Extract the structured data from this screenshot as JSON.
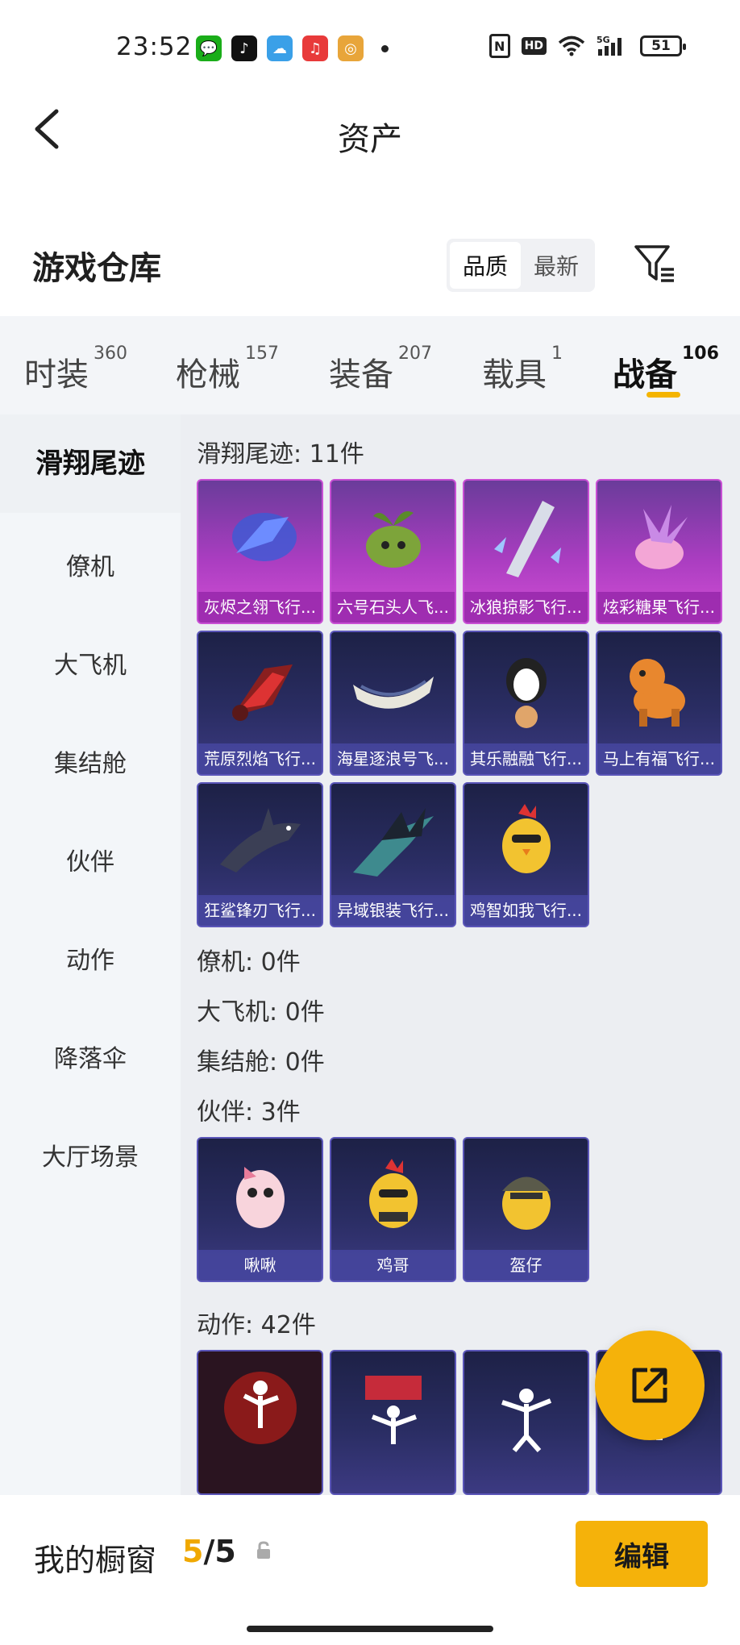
{
  "status": {
    "time": "23:52",
    "battery": "51",
    "network": "5G",
    "hd": "HD"
  },
  "header": {
    "title": "资产"
  },
  "warehouse": {
    "title": "游戏仓库",
    "sort_quality": "品质",
    "sort_newest": "最新"
  },
  "tabs": [
    {
      "label": "时装",
      "count": "360"
    },
    {
      "label": "枪械",
      "count": "157"
    },
    {
      "label": "装备",
      "count": "207"
    },
    {
      "label": "载具",
      "count": "1"
    },
    {
      "label": "战备",
      "count": "106"
    }
  ],
  "sidebar": [
    "滑翔尾迹",
    "僚机",
    "大飞机",
    "集结舱",
    "伙伴",
    "动作",
    "降落伞",
    "大厅场景"
  ],
  "groups": {
    "glide": "滑翔尾迹: 11件",
    "wingman": "僚机: 0件",
    "bigplane": "大飞机: 0件",
    "capsule": "集结舱: 0件",
    "partner": "伙伴: 3件",
    "action": "动作: 42件"
  },
  "glide_items": [
    "灰烬之翎飞行...",
    "六号石头人飞...",
    "冰狼掠影飞行...",
    "炫彩糖果飞行...",
    "荒原烈焰飞行...",
    "海星逐浪号飞...",
    "其乐融融飞行...",
    "马上有福飞行...",
    "狂鲨锋刃飞行...",
    "异域银装飞行...",
    "鸡智如我飞行..."
  ],
  "partner_items": [
    "啾啾",
    "鸡哥",
    "盔仔"
  ],
  "footer": {
    "label": "我的橱窗",
    "count_current": "5",
    "count_total": "/5",
    "edit": "编辑"
  },
  "colors": {
    "accent": "#f5b20a",
    "purple_card": "#a93dc0",
    "blue_card": "#2a2d63"
  }
}
